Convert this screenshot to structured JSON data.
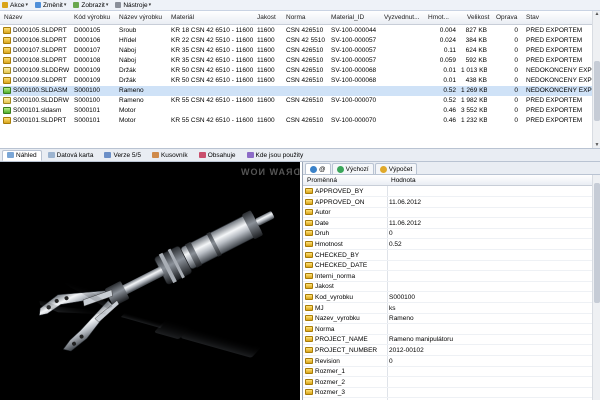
{
  "menubar": {
    "items": [
      {
        "label": "Akce",
        "icon": "actions-icon"
      },
      {
        "label": "Změnit",
        "icon": "change-icon"
      },
      {
        "label": "Zobrazit",
        "icon": "view-icon"
      },
      {
        "label": "Nástroje",
        "icon": "tools-icon"
      }
    ]
  },
  "grid": {
    "columns": [
      "Název",
      "Kód výrobku",
      "Název výrobku",
      "Materiál",
      "Jakost",
      "Norma",
      "Material_ID",
      "Vyzvednut...",
      "Hmot...",
      "Velikost",
      "Oprava",
      "Stav"
    ],
    "rows": [
      {
        "type": "part",
        "name": "D000105.SLDPRT",
        "code": "D000105",
        "product": "Šroub",
        "material": "KR 18 ČSN 42 6510 - 11600",
        "grade": "11600",
        "norm": "ČSN 426510",
        "mat_id": "SV-100-000044",
        "checked": "",
        "mass": "0.004",
        "size": "827 KB",
        "fix": "0",
        "state": "PŘED EXPORTEM",
        "selected": false
      },
      {
        "type": "part",
        "name": "D000106.SLDPRT",
        "code": "D000106",
        "product": "Hřídel",
        "material": "KR 22 ČSN 42 5510 - 11600",
        "grade": "11600",
        "norm": "ČSN 42 5510",
        "mat_id": "SV-100-000057",
        "checked": "",
        "mass": "0.024",
        "size": "384 KB",
        "fix": "0",
        "state": "PŘED EXPORTEM",
        "selected": false
      },
      {
        "type": "part",
        "name": "D000107.SLDPRT",
        "code": "D000107",
        "product": "Náboj",
        "material": "KR 35 ČSN 42 6510 - 11600",
        "grade": "11600",
        "norm": "ČSN 426510",
        "mat_id": "SV-100-000057",
        "checked": "",
        "mass": "0.11",
        "size": "624 KB",
        "fix": "0",
        "state": "PŘED EXPORTEM",
        "selected": false
      },
      {
        "type": "part",
        "name": "D000108.SLDPRT",
        "code": "D000108",
        "product": "Náboj",
        "material": "KR 35 ČSN 42 6510 - 11600",
        "grade": "11600",
        "norm": "ČSN 426510",
        "mat_id": "SV-100-000057",
        "checked": "",
        "mass": "0.059",
        "size": "592 KB",
        "fix": "0",
        "state": "PŘED EXPORTEM",
        "selected": false
      },
      {
        "type": "drw",
        "name": "D000109.SLDDRW",
        "code": "D000109",
        "product": "Držák",
        "material": "KR 50 ČSN 42 6510 - 11600",
        "grade": "11600",
        "norm": "ČSN 426510",
        "mat_id": "SV-100-000068",
        "checked": "",
        "mass": "0.01",
        "size": "1 013 KB",
        "fix": "0",
        "state": "NEDOKONČENÝ EXPORT",
        "selected": false
      },
      {
        "type": "part",
        "name": "D000109.SLDPRT",
        "code": "D000109",
        "product": "Držák",
        "material": "KR 50 ČSN 42 6510 - 11600",
        "grade": "11600",
        "norm": "ČSN 426510",
        "mat_id": "SV-100-000068",
        "checked": "",
        "mass": "0.01",
        "size": "438 KB",
        "fix": "0",
        "state": "NEDOKONČENÝ EXPORT",
        "selected": false
      },
      {
        "type": "asm",
        "name": "S000100.SLDASM",
        "code": "S000100",
        "product": "Rameno",
        "material": "",
        "grade": "",
        "norm": "",
        "mat_id": "",
        "checked": "",
        "mass": "0.52",
        "size": "1 269 KB",
        "fix": "0",
        "state": "NEDOKONČENÝ EXPORT",
        "selected": true
      },
      {
        "type": "drw",
        "name": "S000100.SLDDRW",
        "code": "S000100",
        "product": "Rameno",
        "material": "KR 55 ČSN 42 6510 - 11600",
        "grade": "11600",
        "norm": "ČSN 426510",
        "mat_id": "SV-100-000070",
        "checked": "",
        "mass": "0.52",
        "size": "1 982 KB",
        "fix": "0",
        "state": "PŘED EXPORTEM",
        "selected": false
      },
      {
        "type": "asm",
        "name": "S000101.sldasm",
        "code": "S000101",
        "product": "Motor",
        "material": "",
        "grade": "",
        "norm": "",
        "mat_id": "",
        "checked": "",
        "mass": "0.46",
        "size": "3 552 KB",
        "fix": "0",
        "state": "PŘED EXPORTEM",
        "selected": false
      },
      {
        "type": "part",
        "name": "S000101.SLDPRT",
        "code": "S000101",
        "product": "Motor",
        "material": "KR 55 ČSN 42 6510 - 11600",
        "grade": "11600",
        "norm": "ČSN 426510",
        "mat_id": "SV-100-000070",
        "checked": "",
        "mass": "0.46",
        "size": "1 232 KB",
        "fix": "0",
        "state": "PŘED EXPORTEM",
        "selected": false
      }
    ]
  },
  "tabs": [
    {
      "label": "Náhled",
      "icon": "preview-icon",
      "active": true
    },
    {
      "label": "Datová karta",
      "icon": "datacard-icon",
      "active": false
    },
    {
      "label": "Verze 5/5",
      "icon": "version-icon",
      "active": false
    },
    {
      "label": "Kusovník",
      "icon": "bom-icon",
      "active": false
    },
    {
      "label": "Obsahuje",
      "icon": "contains-icon",
      "active": false
    },
    {
      "label": "Kde jsou použity",
      "icon": "where-used-icon",
      "active": false
    }
  ],
  "preview": {
    "watermark": "DRAW NOW"
  },
  "props": {
    "tabs": [
      {
        "label": "@",
        "icon": "config-icon",
        "active": true
      },
      {
        "label": "Výchozí",
        "icon": "default-icon",
        "active": false
      },
      {
        "label": "Výpočet",
        "icon": "calc-icon",
        "active": false
      }
    ],
    "header_name": "Proměnná",
    "header_value": "Hodnota",
    "rows": [
      {
        "name": "APPROVED_BY",
        "value": ""
      },
      {
        "name": "APPROVED_ON",
        "value": "11.06.2012"
      },
      {
        "name": "Autor",
        "value": ""
      },
      {
        "name": "Date",
        "value": "11.06.2012"
      },
      {
        "name": "Druh",
        "value": "0"
      },
      {
        "name": "Hmotnost",
        "value": "0.52"
      },
      {
        "name": "CHECKED_BY",
        "value": ""
      },
      {
        "name": "CHECKED_DATE",
        "value": ""
      },
      {
        "name": "Interni_norma",
        "value": ""
      },
      {
        "name": "Jakost",
        "value": ""
      },
      {
        "name": "Kod_vyrobku",
        "value": "S000100"
      },
      {
        "name": "MJ",
        "value": "ks"
      },
      {
        "name": "Nazev_vyrobku",
        "value": "Rameno"
      },
      {
        "name": "Norma",
        "value": ""
      },
      {
        "name": "PROJECT_NAME",
        "value": "Rameno manipulátoru"
      },
      {
        "name": "PROJECT_NUMBER",
        "value": "2012-00102"
      },
      {
        "name": "Revision",
        "value": "0"
      },
      {
        "name": "Rozmer_1",
        "value": ""
      },
      {
        "name": "Rozmer_2",
        "value": ""
      },
      {
        "name": "Rozmer_3",
        "value": ""
      },
      {
        "name": "",
        "value": ""
      }
    ]
  }
}
